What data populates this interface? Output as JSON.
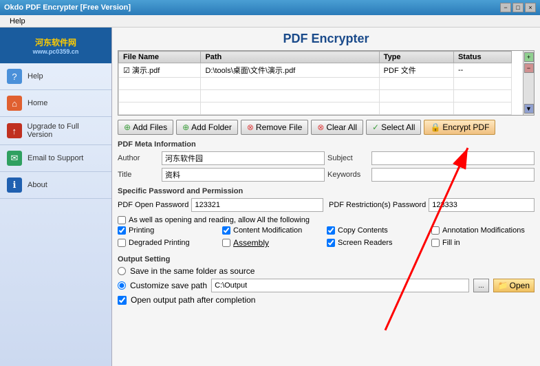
{
  "titlebar": {
    "title": "Okdo PDF Encrypter [Free Version]",
    "min": "−",
    "max": "□",
    "close": "×"
  },
  "menubar": {
    "items": [
      "Help"
    ]
  },
  "sidebar": {
    "logo_line1": "河东软件网",
    "logo_line2": "www.pc0359.cn",
    "items": [
      {
        "id": "help",
        "label": "Help",
        "icon": "?"
      },
      {
        "id": "home",
        "label": "Home",
        "icon": "⌂"
      },
      {
        "id": "upgrade",
        "label": "Upgrade to Full Version",
        "icon": "↑"
      },
      {
        "id": "email",
        "label": "Email to Support",
        "icon": "✉"
      },
      {
        "id": "about",
        "label": "About",
        "icon": "ℹ"
      }
    ]
  },
  "content": {
    "title": "PDF Encrypter",
    "table": {
      "columns": [
        "File Name",
        "Path",
        "Type",
        "Status"
      ],
      "rows": [
        {
          "filename": "☑ 演示.pdf",
          "path": "D:\\tools\\桌面\\文件\\演示.pdf",
          "type": "PDF 文件",
          "status": "--"
        }
      ]
    },
    "toolbar": {
      "add_files": "Add Files",
      "add_folder": "Add Folder",
      "remove_file": "Remove File",
      "clear_all": "Clear All",
      "select_all": "Select All",
      "encrypt_pdf": "Encrypt PDF"
    },
    "meta": {
      "section_title": "PDF Meta Information",
      "author_label": "Author",
      "author_value": "河东软件园",
      "title_label": "Title",
      "title_value": "资料",
      "subject_label": "Subject",
      "subject_value": "",
      "keywords_label": "Keywords",
      "keywords_value": ""
    },
    "password": {
      "section_title": "Specific Password and Permission",
      "open_label": "PDF Open Password",
      "open_value": "123321",
      "restriction_label": "PDF Restriction(s) Password",
      "restriction_value": "123333",
      "allow_label": "As well as opening and reading, allow All the following",
      "checkboxes": [
        {
          "id": "printing",
          "label": "Printing",
          "checked": true
        },
        {
          "id": "content_mod",
          "label": "Content Modification",
          "checked": true
        },
        {
          "id": "copy_contents",
          "label": "Copy Contents",
          "checked": true
        },
        {
          "id": "annotation_mod",
          "label": "Annotation Modifications",
          "checked": false
        },
        {
          "id": "degraded",
          "label": "Degraded Printing",
          "checked": false
        },
        {
          "id": "assembly",
          "label": "Assembly",
          "checked": false
        },
        {
          "id": "screen_readers",
          "label": "Screen Readers",
          "checked": true
        },
        {
          "id": "fill_in",
          "label": "Fill in",
          "checked": false
        }
      ]
    },
    "output": {
      "section_title": "Output Setting",
      "same_folder_label": "Save in the same folder as source",
      "customize_label": "Customize save path",
      "path_value": "C:\\Output",
      "browse_label": "...",
      "open_label": "Open",
      "open_after_label": "Open output path after completion"
    }
  }
}
